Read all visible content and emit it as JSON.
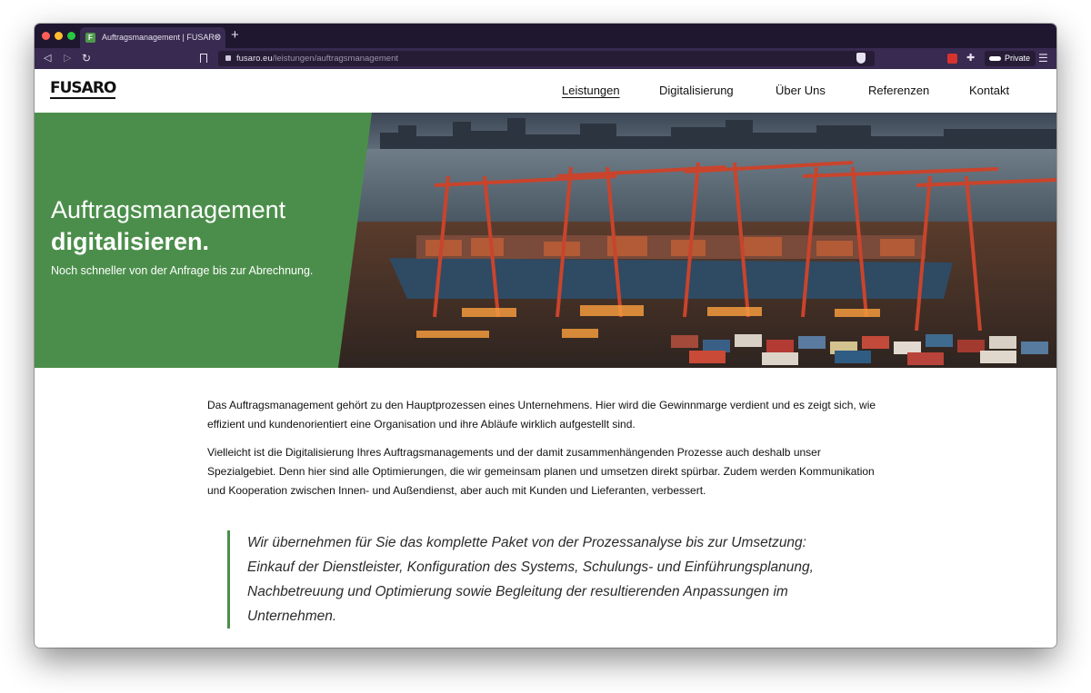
{
  "browser": {
    "tab_title": "Auftragsmanagement | FUSARO",
    "tab_favicon_letter": "F",
    "tab_close": "×",
    "new_tab": "+",
    "url_domain": "fusaro.eu",
    "url_path": "/leistungen/auftragsmanagement",
    "private_label": "Private",
    "icons": [
      "back-icon",
      "forward-icon",
      "reload-icon",
      "bookmark-icon",
      "lock-icon",
      "brave-shield-icon",
      "extension-icon",
      "puzzle-icon",
      "private-mask-icon",
      "menu-icon"
    ]
  },
  "site": {
    "logo": "FUSARO",
    "nav": [
      {
        "label": "Leistungen",
        "active": true
      },
      {
        "label": "Digitalisierung",
        "active": false
      },
      {
        "label": "Über Uns",
        "active": false
      },
      {
        "label": "Referenzen",
        "active": false
      },
      {
        "label": "Kontakt",
        "active": false
      }
    ],
    "accent_color": "#4b8e4b"
  },
  "hero": {
    "title_line1": "Auftragsmanagement",
    "title_line2": "digitalisieren.",
    "subtitle": "Noch schneller von der Anfrage bis zur Abrechnung.",
    "image": "container-port-cranes-photo"
  },
  "article": {
    "paragraph1": "Das Auftragsmanagement gehört zu den Hauptprozessen eines Unternehmens. Hier wird die Gewinnmarge verdient und es zeigt sich, wie effizient und kundenorientiert eine Organisation und ihre Abläufe wirklich aufgestellt sind.",
    "paragraph2": "Vielleicht ist die Digitalisierung Ihres Auftragsmanagements und der damit zusammenhängenden Prozesse auch deshalb unser Spezialgebiet. Denn hier sind alle Optimierungen, die wir gemeinsam planen und umsetzen direkt spürbar. Zudem werden Kommunikation und Kooperation zwischen Innen- und Außendienst, aber auch mit Kunden und Lieferanten, verbessert.",
    "quote": "Wir übernehmen für Sie das komplette Paket von der Prozessanalyse bis zur Umsetzung: Einkauf der Dienstleister, Konfiguration des Systems, Schulungs- und Einführungsplanung, Nachbetreuung und Optimierung sowie Begleitung der resultierenden Anpassungen im Unternehmen."
  }
}
